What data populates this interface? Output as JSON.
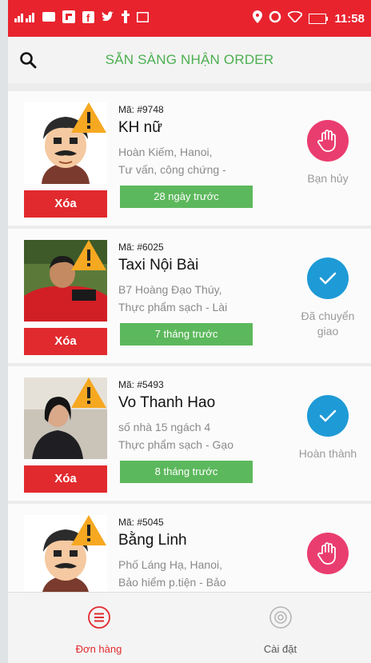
{
  "status_bar": {
    "time": "11:58",
    "battery": "88"
  },
  "header": {
    "title": "SẴN SÀNG NHẬN ORDER"
  },
  "orders": [
    {
      "code": "Mã: #9748",
      "name": "KH nữ",
      "address": "Hoàn Kiếm, Hanoi,",
      "service": "Tư vấn, công chứng -",
      "time_ago": "28 ngày trước",
      "delete_label": "Xóa",
      "status_label": "Bạn hủy",
      "status_icon": "hand-icon"
    },
    {
      "code": "Mã: #6025",
      "name": "Taxi Nội Bài",
      "address": "B7 Hoàng Đạo Thúy,",
      "service": "Thực phẩm sạch - Lài",
      "time_ago": "7 tháng trước",
      "delete_label": "Xóa",
      "status_label": "Đã chuyển giao",
      "status_icon": "check-icon"
    },
    {
      "code": "Mã: #5493",
      "name": "Vo Thanh Hao",
      "address": "số nhà 15 ngách 4",
      "service": "Thực phẩm sạch - Gạo",
      "time_ago": "8 tháng trước",
      "delete_label": "Xóa",
      "status_label": "Hoàn thành",
      "status_icon": "check-icon"
    },
    {
      "code": "Mã: #5045",
      "name": "Bằng Linh",
      "address": "Phố Láng Hạ, Hanoi,",
      "service": "Bảo hiểm p.tiện - Bảo",
      "time_ago": "",
      "delete_label": "Xóa",
      "status_label": "",
      "status_icon": "hand-icon"
    }
  ],
  "bottom_nav": {
    "orders_label": "Đơn hàng",
    "settings_label": "Cài đặt"
  },
  "colors": {
    "status_bar": "#e8232e",
    "title_green": "#4caf50",
    "delete_red": "#e12a2e",
    "badge_green": "#5cb85c",
    "cancel_pink": "#ea3d6f",
    "done_blue": "#1e9ad6"
  }
}
